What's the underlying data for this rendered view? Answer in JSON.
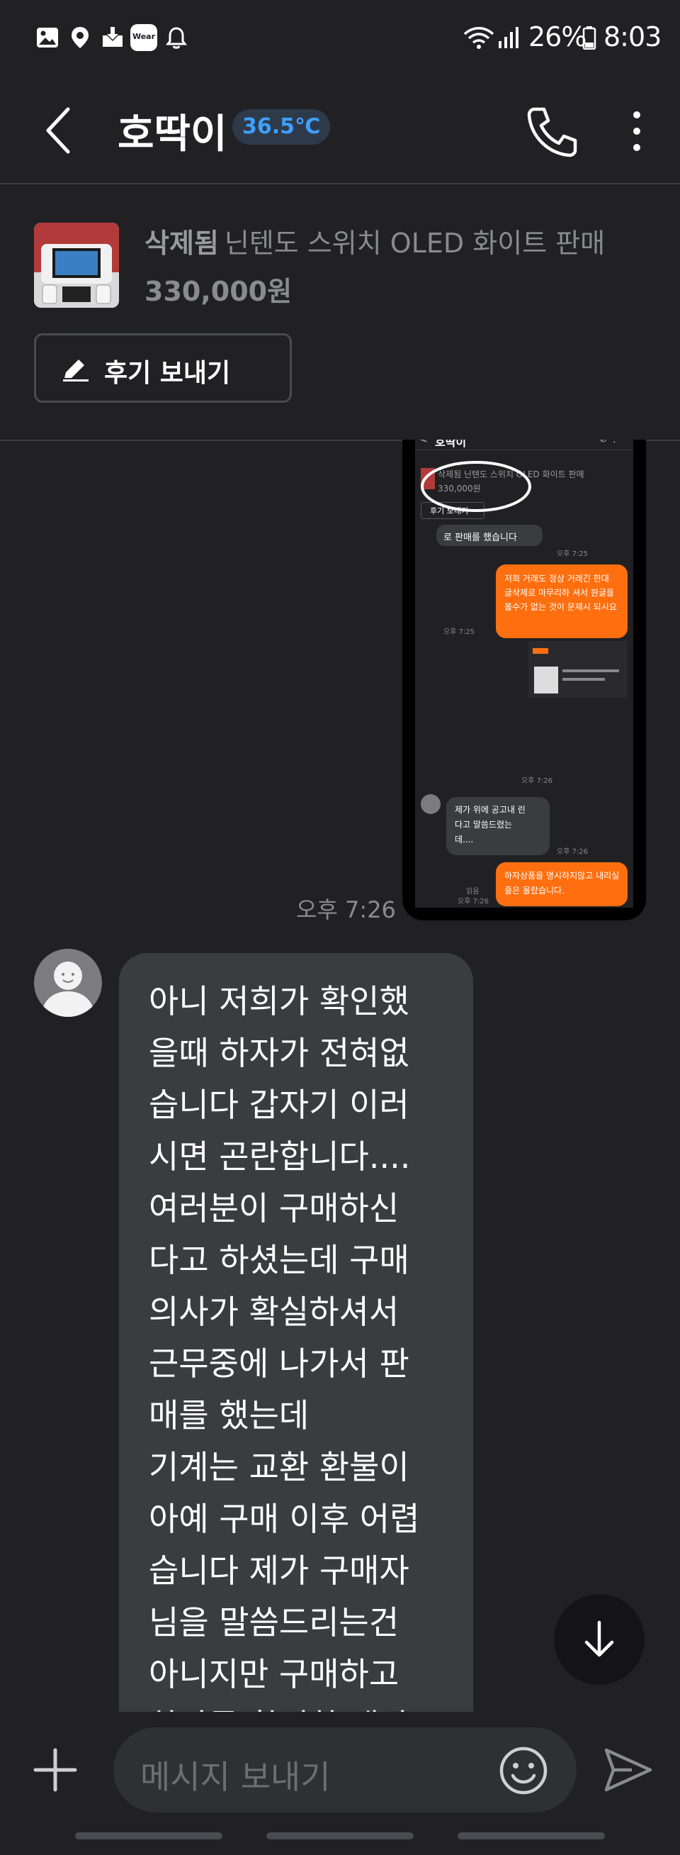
{
  "status_bar": {
    "battery": "26%",
    "time": "8:03",
    "wear_label": "Wear",
    "icons": [
      "gallery-icon",
      "location-icon",
      "download-icon",
      "wear-icon",
      "bell-icon",
      "wifi-icon",
      "signal-icon",
      "battery-icon"
    ]
  },
  "header": {
    "seller_name": "호딱이",
    "temperature": "36.5℃",
    "temperature_color": "#3ea0ff"
  },
  "product": {
    "status": "삭제됨",
    "title": "닌텐도 스위치 OLED 화이트 판매",
    "price": "330,000원",
    "review_button": "후기 보내기"
  },
  "image_message": {
    "time": "오후 7:26",
    "inner": {
      "header_name": "호딱이",
      "prod_line": "삭제됨 닌텐도 스위치 OLED 화이트 판매",
      "prod_price": "330,000원",
      "review": "후기 보내기",
      "msg1": "로 판매를 했습니다",
      "time1": "오후 7:25",
      "msg2": "저희 거래도 정상 거래긴 한대 글삭제로 마무리하 셔서 원글을 볼수가 없는 것이 문제시 되시요",
      "time2": "오후 7:25",
      "time3": "오후 7:26",
      "msg3": "제가 위에 공고내 린다고 말씀드렸는 데....",
      "time4": "오후 7:26",
      "msg4": "하자상품을 명시하지않고 내리실줄은 몰랐습니다.",
      "time5": "오후 7:26",
      "read": "읽음"
    }
  },
  "message": {
    "text": "아니 저희가 확인했\n을때 하자가 전혀없\n습니다 갑자기 이러\n시면 곤란합니다....\n여러분이 구매하신\n다고 하셨는데 구매\n의사가 확실하셔서\n근무중에 나가서 판\n매를 했는데\n기계는 교환 환불이\n아예 구매 이후 어렵\n습니다 제가 구매자\n님을 말씀드리는건\n아니지만 구매하고\n하자를 확인한 생각"
  },
  "input": {
    "placeholder": "메시지 보내기"
  },
  "colors": {
    "background": "#212124",
    "bubble": "#3b3c40",
    "accent_orange": "#ff6f0f"
  }
}
